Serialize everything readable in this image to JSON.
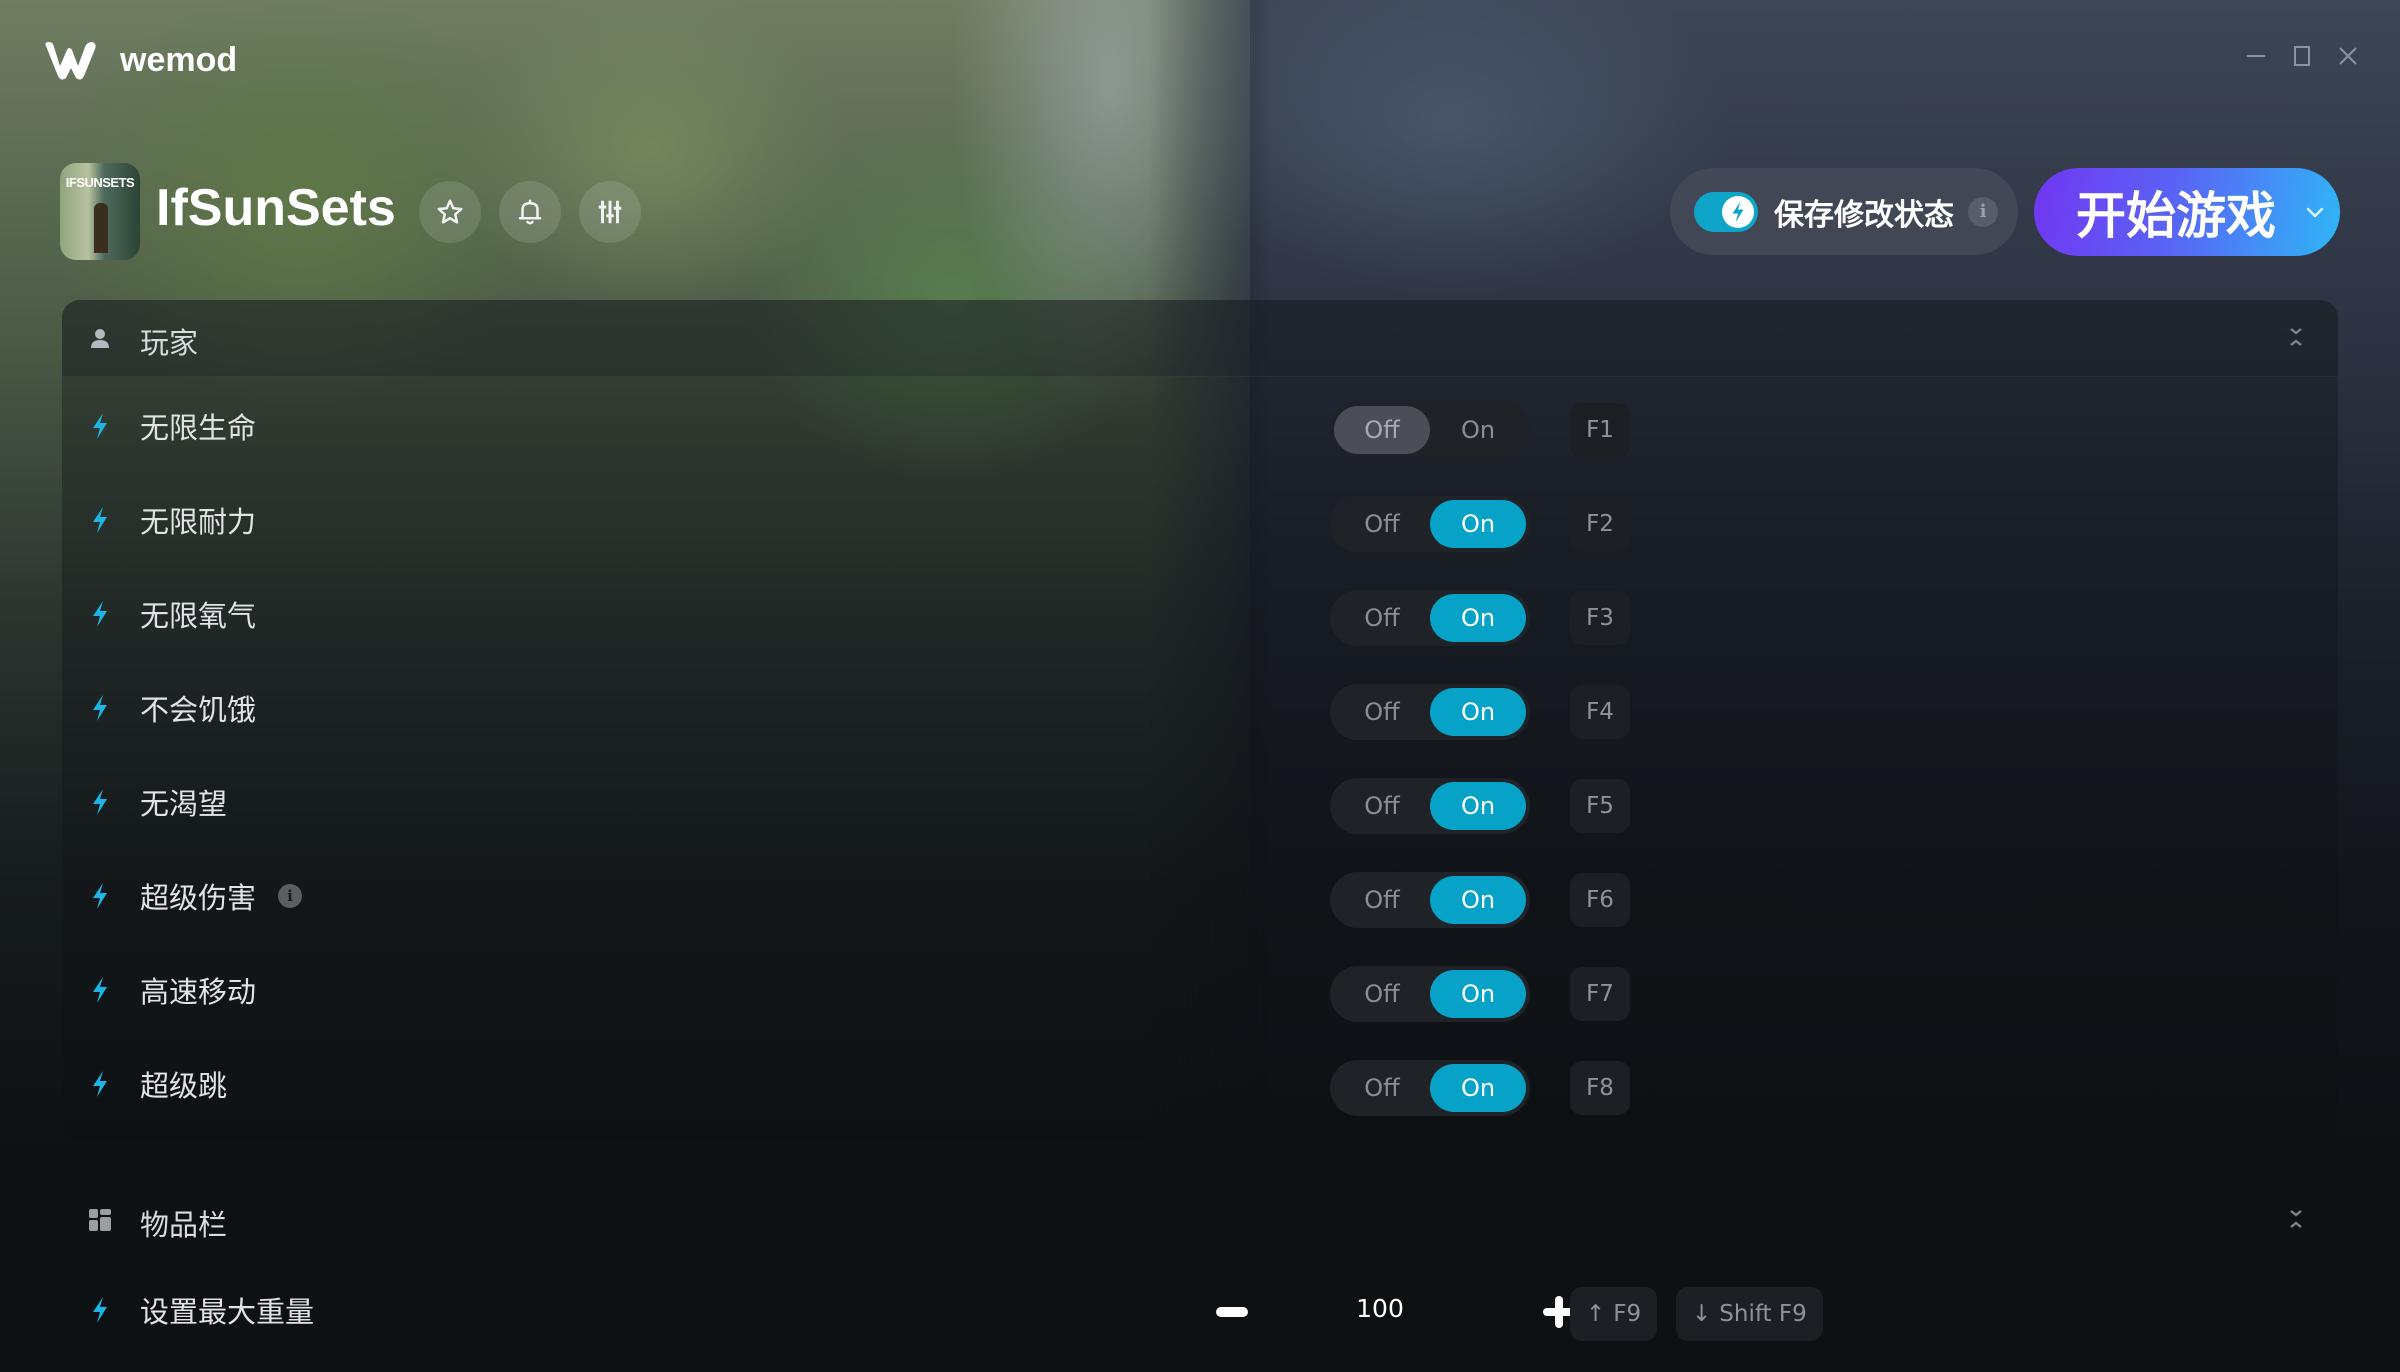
{
  "app": {
    "name": "wemod",
    "window_controls": [
      "minimize",
      "maximize",
      "close"
    ]
  },
  "game": {
    "title": "IfSunSets",
    "thumbnail_text": "IFSUNSETS",
    "header_buttons": [
      {
        "name": "favorite",
        "icon": "star-icon"
      },
      {
        "name": "notifications",
        "icon": "bell-icon"
      },
      {
        "name": "settings",
        "icon": "sliders-icon"
      }
    ],
    "save_mods": {
      "label": "保存修改状态",
      "enabled": true,
      "info": "i"
    },
    "play_button": {
      "label": "开始游戏"
    }
  },
  "colors": {
    "accent": "#07a2c8",
    "play_gradient_start": "#7236f2",
    "play_gradient_end": "#2fb6f6",
    "bolt": "#1cb5e6"
  },
  "sections": [
    {
      "title": "玩家",
      "icon": "user-icon",
      "toggle_labels": {
        "off": "Off",
        "on": "On"
      },
      "cheats": [
        {
          "label": "无限生命",
          "state": "off",
          "hotkey": "F1"
        },
        {
          "label": "无限耐力",
          "state": "on",
          "hotkey": "F2"
        },
        {
          "label": "无限氧气",
          "state": "on",
          "hotkey": "F3"
        },
        {
          "label": "不会饥饿",
          "state": "on",
          "hotkey": "F4"
        },
        {
          "label": "无渴望",
          "state": "on",
          "hotkey": "F5"
        },
        {
          "label": "超级伤害",
          "state": "on",
          "hotkey": "F6",
          "info": "i"
        },
        {
          "label": "高速移动",
          "state": "on",
          "hotkey": "F7"
        },
        {
          "label": "超级跳",
          "state": "on",
          "hotkey": "F8"
        }
      ]
    },
    {
      "title": "物品栏",
      "icon": "inventory-grid-icon",
      "cheats": [
        {
          "label": "设置最大重量",
          "type": "stepper",
          "value": "100",
          "hotkey_increase": "F9",
          "hotkey_decrease": "Shift F9"
        }
      ]
    }
  ]
}
